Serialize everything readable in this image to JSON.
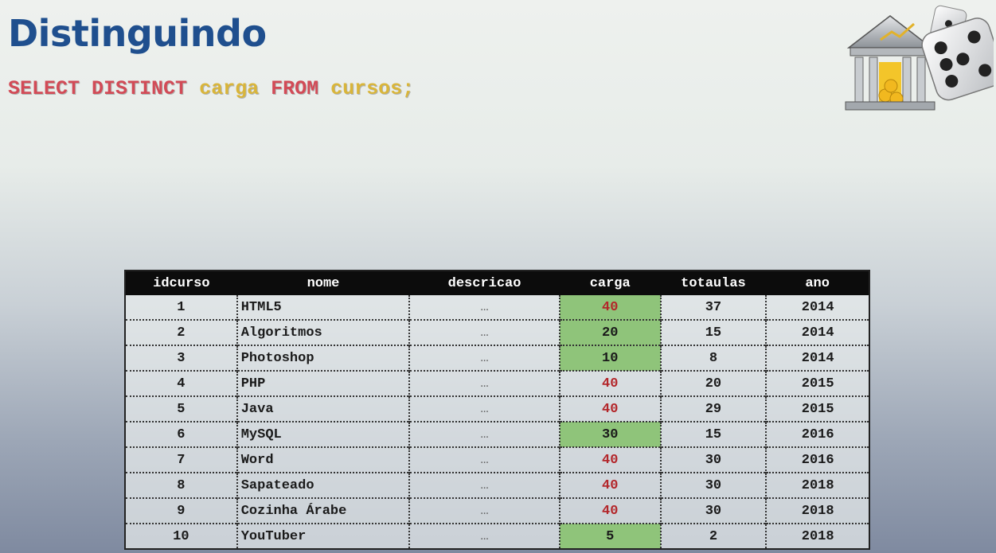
{
  "title": "Distinguindo",
  "sql": {
    "kw1": "SELECT DISTINCT",
    "col": "carga",
    "kw2": "FROM",
    "table": "cursos;"
  },
  "colors": {
    "title": "#1f4f8e",
    "keyword": "#d24b57",
    "identifier": "#d9b53a",
    "header_bg": "#0c0c0c",
    "highlight_green": "#8fc47a",
    "repeat_red": "#b3262a"
  },
  "icons": {
    "logo": "bank-dice-icon"
  },
  "table": {
    "headers": [
      "idcurso",
      "nome",
      "descricao",
      "carga",
      "totaulas",
      "ano"
    ],
    "rows": [
      [
        "1",
        "HTML5",
        "…",
        "40",
        "37",
        "2014"
      ],
      [
        "2",
        "Algoritmos",
        "…",
        "20",
        "15",
        "2014"
      ],
      [
        "3",
        "Photoshop",
        "…",
        "10",
        "8",
        "2014"
      ],
      [
        "4",
        "PHP",
        "…",
        "40",
        "20",
        "2015"
      ],
      [
        "5",
        "Java",
        "…",
        "40",
        "29",
        "2015"
      ],
      [
        "6",
        "MySQL",
        "…",
        "30",
        "15",
        "2016"
      ],
      [
        "7",
        "Word",
        "…",
        "40",
        "30",
        "2016"
      ],
      [
        "8",
        "Sapateado",
        "…",
        "40",
        "30",
        "2018"
      ],
      [
        "9",
        "Cozinha Árabe",
        "…",
        "40",
        "30",
        "2018"
      ],
      [
        "10",
        "YouTuber",
        "…",
        "5",
        "2",
        "2018"
      ]
    ],
    "carga_highlight": [
      true,
      true,
      true,
      false,
      false,
      true,
      false,
      false,
      false,
      true
    ],
    "carga_red": [
      true,
      false,
      false,
      true,
      true,
      false,
      true,
      true,
      true,
      false
    ]
  }
}
